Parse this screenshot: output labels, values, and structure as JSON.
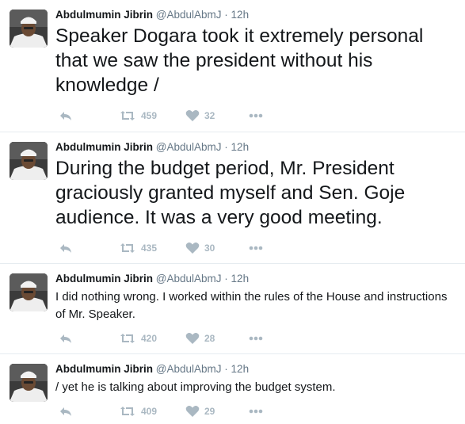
{
  "colors": {
    "name": "#14171a",
    "secondary": "#657786",
    "action_icon": "#aab8c2",
    "divider": "#e6ecf0"
  },
  "tweets": [
    {
      "name": "Abdulmumin Jibrin",
      "handle": "@AbdulAbmJ",
      "sep": "·",
      "time": "12h",
      "text": "Speaker Dogara took it extremely personal that we saw the president without his knowledge /",
      "retweets": "459",
      "likes": "32"
    },
    {
      "name": "Abdulmumin Jibrin",
      "handle": "@AbdulAbmJ",
      "sep": "·",
      "time": "12h",
      "text": "During the budget period, Mr. President graciously granted myself and Sen. Goje audience. It was a very good meeting.",
      "retweets": "435",
      "likes": "30"
    },
    {
      "name": "Abdulmumin Jibrin",
      "handle": "@AbdulAbmJ",
      "sep": "·",
      "time": "12h",
      "text": "I did nothing wrong. I worked within the rules of the House and instructions of Mr. Speaker.",
      "retweets": "420",
      "likes": "28"
    },
    {
      "name": "Abdulmumin Jibrin",
      "handle": "@AbdulAbmJ",
      "sep": "·",
      "time": "12h",
      "text": "/ yet he is talking about improving the budget system.",
      "retweets": "409",
      "likes": "29"
    }
  ],
  "icons": {
    "avatar": "profile-photo",
    "reply": "reply-icon",
    "retweet": "retweet-icon",
    "like": "heart-icon",
    "more": "more-icon"
  }
}
